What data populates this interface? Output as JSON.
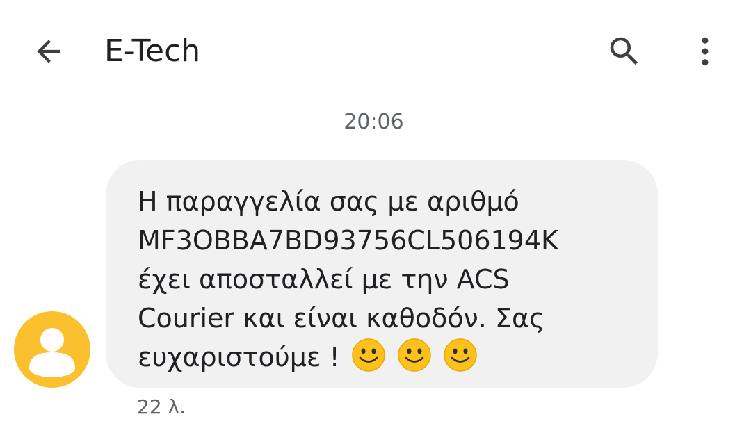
{
  "header": {
    "back_icon": "arrow-left-icon",
    "title": "E-Tech",
    "search_icon": "search-icon",
    "more_icon": "more-vertical-icon"
  },
  "conversation": {
    "timestamp": "20:06",
    "avatar_icon": "person-icon",
    "avatar_color": "#fbc02d",
    "message": {
      "text": "Η παραγγελία σας με αριθμό\nMF3OBBA7BD93756CL506194K\nέχει αποσταλλεί με την ACS\nCourier και είναι καθοδόν. Σας\nευχαριστούμε !",
      "emojis": [
        "slightly-smiling-face-icon",
        "slightly-smiling-face-icon",
        "slightly-smiling-face-icon"
      ],
      "time": "22 λ."
    }
  }
}
